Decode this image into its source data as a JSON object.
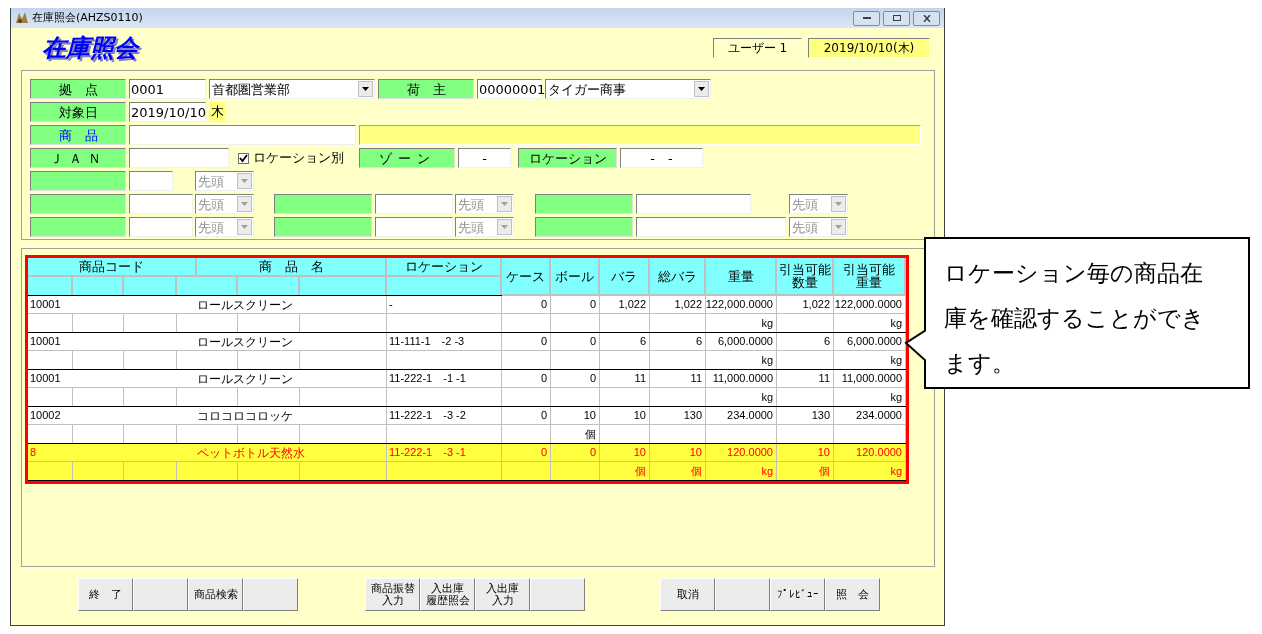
{
  "window": {
    "title": "在庫照会(AHZS0110)"
  },
  "header": {
    "title": "在庫照会",
    "user": "ユーザー 1",
    "date": "2019/10/10(木)"
  },
  "filters": {
    "base": {
      "label": "拠　点",
      "code": "0001",
      "name": "首都圏営業部"
    },
    "owner": {
      "label": "荷　主",
      "code": "00000001",
      "name": "タイガー商事"
    },
    "target_date": {
      "label": "対象日",
      "value": "2019/10/10",
      "weekday": "木"
    },
    "product": {
      "label": "商　品"
    },
    "jan": {
      "label": "ＪＡＮ"
    },
    "by_location": {
      "label": "ロケーション別",
      "checked": true
    },
    "zone": {
      "label": "ゾーン",
      "value": "-"
    },
    "location": {
      "label": "ロケーション",
      "value": "-　-"
    },
    "sort_rows": [
      [
        {
          "order": "先頭",
          "disabled": true
        }
      ],
      [
        {
          "order": "先頭",
          "disabled": true
        },
        {
          "order": "先頭",
          "disabled": true
        },
        {
          "order": "先頭",
          "disabled": true
        }
      ],
      [
        {
          "order": "先頭",
          "disabled": true
        },
        {
          "order": "先頭",
          "disabled": true
        },
        {
          "order": "先頭",
          "disabled": true
        }
      ]
    ]
  },
  "table": {
    "columns": [
      {
        "label": "商品コード"
      },
      {
        "label": "商　品　名"
      },
      {
        "label": "ロケーション"
      },
      {
        "label": "ケース"
      },
      {
        "label": "ボール"
      },
      {
        "label": "バラ"
      },
      {
        "label": "総バラ"
      },
      {
        "label": "重量"
      },
      {
        "lines": [
          "引当可能",
          "数量"
        ]
      },
      {
        "lines": [
          "引当可能",
          "重量"
        ]
      }
    ],
    "rows": [
      {
        "code": "10001",
        "name": "ロールスクリーン",
        "location": "-",
        "highlighted": false,
        "quantities": [
          {
            "value": "0"
          },
          {
            "value": "0"
          },
          {
            "value": "1,022"
          },
          {
            "value": "1,022"
          },
          {
            "value": "122,000.0000",
            "unit": "kg"
          },
          {
            "value": "1,022"
          },
          {
            "value": "122,000.0000",
            "unit": "kg"
          }
        ]
      },
      {
        "code": "10001",
        "name": "ロールスクリーン",
        "location": "11-111-1　-2 -3",
        "highlighted": false,
        "quantities": [
          {
            "value": "0"
          },
          {
            "value": "0"
          },
          {
            "value": "6"
          },
          {
            "value": "6"
          },
          {
            "value": "6,000.0000",
            "unit": "kg"
          },
          {
            "value": "6"
          },
          {
            "value": "6,000.0000",
            "unit": "kg"
          }
        ]
      },
      {
        "code": "10001",
        "name": "ロールスクリーン",
        "location": "11-222-1　-1 -1",
        "highlighted": false,
        "quantities": [
          {
            "value": "0"
          },
          {
            "value": "0"
          },
          {
            "value": "11"
          },
          {
            "value": "11"
          },
          {
            "value": "11,000.0000",
            "unit": "kg"
          },
          {
            "value": "11"
          },
          {
            "value": "11,000.0000",
            "unit": "kg"
          }
        ]
      },
      {
        "code": "10002",
        "name": "コロコロコロッケ",
        "location": "11-222-1　-3 -2",
        "highlighted": false,
        "quantities": [
          {
            "value": "0"
          },
          {
            "value": "10",
            "unit": "個"
          },
          {
            "value": "10"
          },
          {
            "value": "130"
          },
          {
            "value": "234.0000"
          },
          {
            "value": "130"
          },
          {
            "value": "234.0000"
          }
        ]
      },
      {
        "code": "8",
        "name": "ペットボトル天然水",
        "location": "11-222-1　-3 -1",
        "highlighted": true,
        "quantities": [
          {
            "value": "0"
          },
          {
            "value": "0"
          },
          {
            "value": "10",
            "unit": "個"
          },
          {
            "value": "10",
            "unit": "個"
          },
          {
            "value": "120.0000",
            "unit": "kg"
          },
          {
            "value": "10",
            "unit": "個"
          },
          {
            "value": "120.0000",
            "unit": "kg"
          }
        ]
      }
    ]
  },
  "button_groups": [
    [
      {
        "kind": "text",
        "label": "終　了"
      },
      {
        "kind": "blank"
      },
      {
        "kind": "text",
        "label": "商品検索"
      },
      {
        "kind": "blank"
      }
    ],
    [
      {
        "kind": "stacked",
        "lines": [
          "商品振替",
          "入力"
        ]
      },
      {
        "kind": "stacked",
        "lines": [
          "入出庫",
          "履歴照会"
        ]
      },
      {
        "kind": "stacked",
        "lines": [
          "入出庫",
          "入力"
        ]
      },
      {
        "kind": "blank"
      }
    ],
    [
      {
        "kind": "text",
        "label": "取消"
      },
      {
        "kind": "blank"
      },
      {
        "kind": "text",
        "label": "ﾌﾟﾚﾋﾞｭｰ"
      },
      {
        "kind": "text",
        "label": "照　会"
      }
    ]
  ],
  "callout": {
    "text": "ロケーション毎の商品在庫を確認することができます。"
  }
}
